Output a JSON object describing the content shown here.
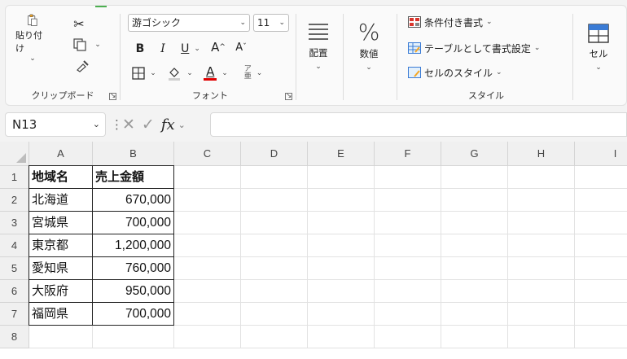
{
  "ribbon": {
    "clipboard": {
      "paste_label": "貼り付け",
      "group_label": "クリップボード"
    },
    "font": {
      "family": "游ゴシック",
      "size": "11",
      "bold": "B",
      "italic": "I",
      "underline": "U",
      "grow": "A",
      "shrink": "A",
      "font_color_letter": "A",
      "group_label": "フォント"
    },
    "alignment": {
      "label": "配置"
    },
    "number": {
      "label": "数値"
    },
    "styles": {
      "conditional_label": "条件付き書式",
      "table_label": "テーブルとして書式設定",
      "cell_style_label": "セルのスタイル",
      "group_label": "スタイル"
    },
    "cells": {
      "label": "セル"
    }
  },
  "formula_bar": {
    "name_box": "N13",
    "fx": "fx",
    "formula": ""
  },
  "columns": [
    "A",
    "B",
    "C",
    "D",
    "E",
    "F",
    "G",
    "H",
    "I"
  ],
  "rows": [
    "1",
    "2",
    "3",
    "4",
    "5",
    "6",
    "7",
    "8"
  ],
  "table": {
    "headers": [
      "地域名",
      "売上金額"
    ],
    "data": [
      [
        "北海道",
        "670,000"
      ],
      [
        "宮城県",
        "700,000"
      ],
      [
        "東京都",
        "1,200,000"
      ],
      [
        "愛知県",
        "760,000"
      ],
      [
        "大阪府",
        "950,000"
      ],
      [
        "福岡県",
        "700,000"
      ]
    ]
  },
  "colors": {
    "font_color_bar": "#e00000",
    "accent_green": "#4caf50"
  }
}
